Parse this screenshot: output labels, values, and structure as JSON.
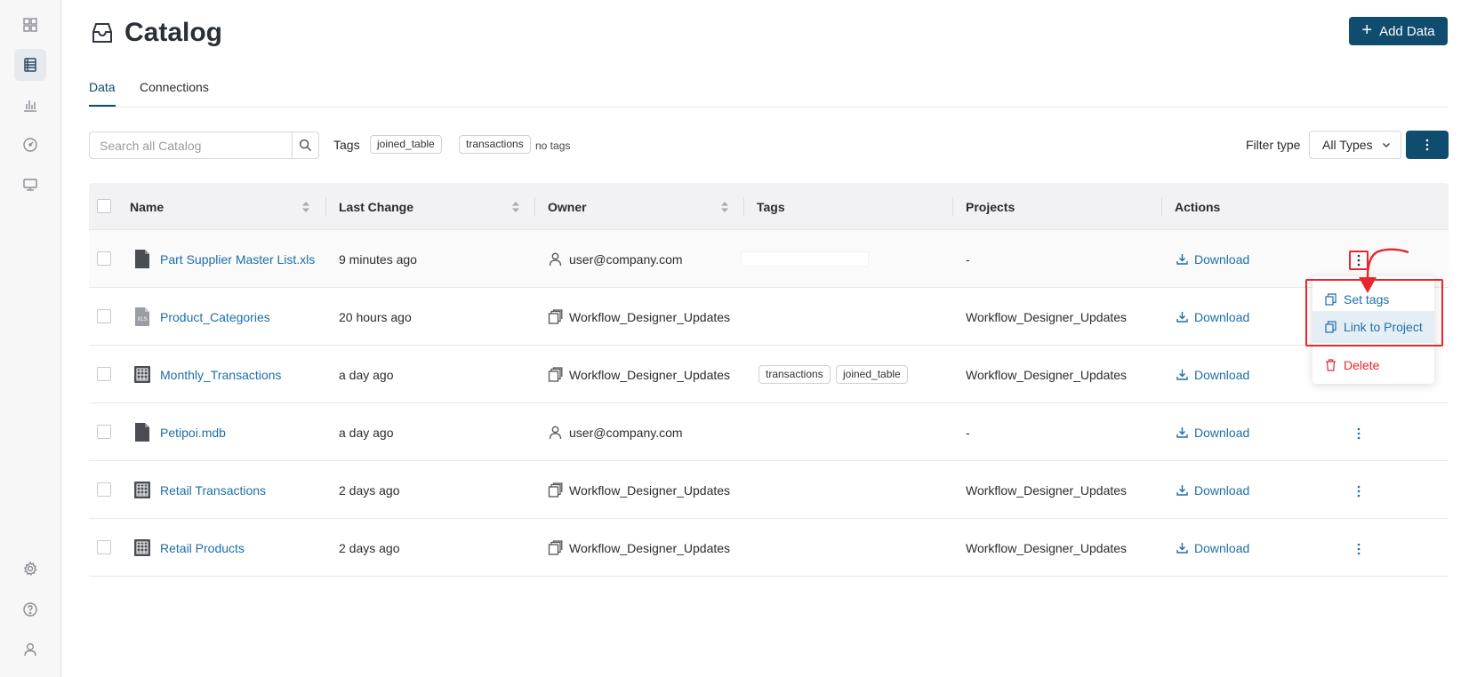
{
  "page": {
    "title": "Catalog",
    "add_button": "Add Data"
  },
  "tabs": [
    {
      "label": "Data",
      "active": true
    },
    {
      "label": "Connections",
      "active": false
    }
  ],
  "toolbar": {
    "search_placeholder": "Search all Catalog",
    "tags_label": "Tags",
    "tag_chips": [
      "joined_table",
      "transactions"
    ],
    "no_tags": "no tags",
    "filter_label": "Filter type",
    "filter_value": "All Types"
  },
  "table": {
    "headers": [
      "Name",
      "Last Change",
      "Owner",
      "Tags",
      "Projects",
      "Actions"
    ],
    "rows": [
      {
        "name": "Part Supplier Master List.xls",
        "icon": "file-icon",
        "last_change": "9 minutes ago",
        "owner": "user@company.com",
        "owner_icon": "user-icon",
        "tags": [],
        "project": "-",
        "action": "Download"
      },
      {
        "name": "Product_Categories",
        "icon": "xls-file-icon",
        "last_change": "20 hours ago",
        "owner": "Workflow_Designer_Updates",
        "owner_icon": "project-icon",
        "tags": [],
        "project": "Workflow_Designer_Updates",
        "action": "Download"
      },
      {
        "name": "Monthly_Transactions",
        "icon": "table-icon",
        "last_change": "a day ago",
        "owner": "Workflow_Designer_Updates",
        "owner_icon": "project-icon",
        "tags": [
          "transactions",
          "joined_table"
        ],
        "project": "Workflow_Designer_Updates",
        "action": "Download"
      },
      {
        "name": "Petipoi.mdb",
        "icon": "file-icon",
        "last_change": "a day ago",
        "owner": "user@company.com",
        "owner_icon": "user-icon",
        "tags": [],
        "project": "-",
        "action": "Download"
      },
      {
        "name": "Retail Transactions",
        "icon": "table-icon",
        "last_change": "2 days ago",
        "owner": "Workflow_Designer_Updates",
        "owner_icon": "project-icon",
        "tags": [],
        "project": "Workflow_Designer_Updates",
        "action": "Download"
      },
      {
        "name": "Retail Products",
        "icon": "table-icon",
        "last_change": "2 days ago",
        "owner": "Workflow_Designer_Updates",
        "owner_icon": "project-icon",
        "tags": [],
        "project": "Workflow_Designer_Updates",
        "action": "Download"
      }
    ]
  },
  "context_menu": {
    "set_tags": "Set tags",
    "link_to_project": "Link to Project",
    "delete": "Delete"
  },
  "colors": {
    "primary": "#0f4c6e",
    "link": "#1e6ea8",
    "danger": "#e8262d",
    "annotation": "#e8262d"
  }
}
